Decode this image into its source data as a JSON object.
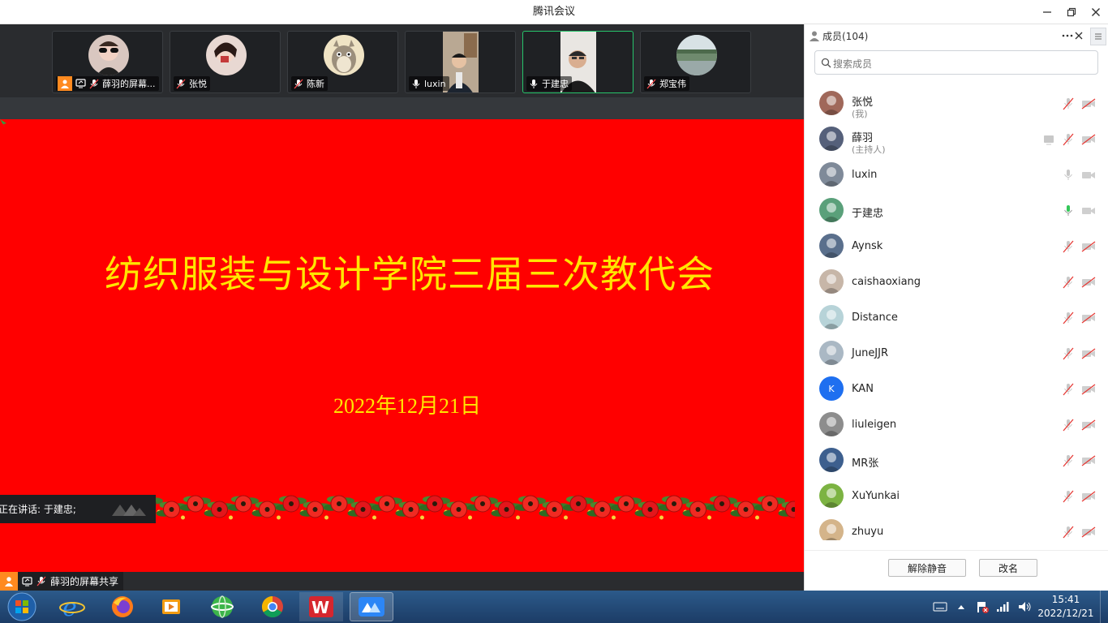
{
  "window": {
    "title": "腾讯会议"
  },
  "video_strip": {
    "tiles": [
      {
        "name": "薛羽的屏幕...",
        "type": "avatar",
        "active": false
      },
      {
        "name": "张悦",
        "type": "avatar",
        "active": false
      },
      {
        "name": "陈新",
        "type": "avatar",
        "active": false
      },
      {
        "name": "luxin",
        "type": "video",
        "active": false
      },
      {
        "name": "于建忠",
        "type": "video",
        "active": true
      },
      {
        "name": "郑宝伟",
        "type": "avatar",
        "active": false
      }
    ]
  },
  "slide": {
    "title": "纺织服装与设计学院三届三次教代会",
    "date": "2022年12月21日",
    "text_color": "#ffe600",
    "background": "#ff0000"
  },
  "speaking": {
    "text": "正在讲话: 于建忠;"
  },
  "share_status": {
    "label": "薛羽的屏幕共享"
  },
  "members_panel": {
    "title": "成员(104)",
    "search_placeholder": "搜索成员",
    "members": [
      {
        "name": "张悦",
        "role": "(我)",
        "mic": "muted",
        "cam": "off",
        "sharing": false,
        "avatar_color": "#a0685a"
      },
      {
        "name": "薛羽",
        "role": "(主持人)",
        "mic": "muted",
        "cam": "off",
        "sharing": true,
        "avatar_color": "#55607a"
      },
      {
        "name": "luxin",
        "role": "",
        "mic": "on",
        "cam": "off",
        "sharing": false,
        "avatar_color": "#7f8a99"
      },
      {
        "name": "于建忠",
        "role": "",
        "mic": "speaking",
        "cam": "off",
        "sharing": false,
        "avatar_color": "#5aa07a"
      },
      {
        "name": "Aynsk",
        "role": "",
        "mic": "muted",
        "cam": "off",
        "sharing": false,
        "avatar_color": "#5a6f8c"
      },
      {
        "name": "caishaoxiang",
        "role": "",
        "mic": "muted",
        "cam": "off",
        "sharing": false,
        "avatar_color": "#c7b6a8"
      },
      {
        "name": "Distance",
        "role": "",
        "mic": "muted",
        "cam": "off",
        "sharing": false,
        "avatar_color": "#b7d3d8"
      },
      {
        "name": "JuneJJR",
        "role": "",
        "mic": "muted",
        "cam": "off",
        "sharing": false,
        "avatar_color": "#aab8c4"
      },
      {
        "name": "KAN",
        "role": "",
        "mic": "muted",
        "cam": "off",
        "sharing": false,
        "avatar_color": "#1e6ff0",
        "initial": "K"
      },
      {
        "name": "liuleigen",
        "role": "",
        "mic": "muted",
        "cam": "off",
        "sharing": false,
        "avatar_color": "#8d8d8d"
      },
      {
        "name": "MR张",
        "role": "",
        "mic": "muted",
        "cam": "off",
        "sharing": false,
        "avatar_color": "#3d5f8e"
      },
      {
        "name": "XuYunkai",
        "role": "",
        "mic": "muted",
        "cam": "off",
        "sharing": false,
        "avatar_color": "#7cb342"
      },
      {
        "name": "zhuyu",
        "role": "",
        "mic": "muted",
        "cam": "off",
        "sharing": false,
        "avatar_color": "#d4b48a"
      }
    ],
    "unmute_button": "解除静音",
    "rename_button": "改名"
  },
  "taskbar": {
    "time": "15:41",
    "date": "2022/12/21",
    "apps": [
      "windows-start",
      "internet-explorer",
      "firefox",
      "media-player",
      "360-browser",
      "chrome",
      "wps",
      "tencent-meeting"
    ]
  }
}
